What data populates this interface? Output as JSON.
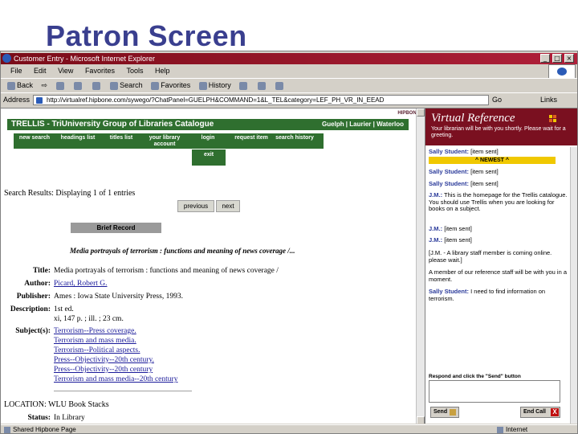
{
  "slide": {
    "title": "Patron Screen"
  },
  "window": {
    "title": "Customer Entry - Microsoft Internet Explorer",
    "controls": {
      "minimize": "_",
      "maximize": "□",
      "close": "×"
    }
  },
  "menu": {
    "items": [
      "File",
      "Edit",
      "View",
      "Favorites",
      "Tools",
      "Help"
    ]
  },
  "toolbar": {
    "items": [
      {
        "label": "Back",
        "icon": "back-arrow-icon"
      },
      {
        "label": "⇨",
        "icon": "forward-arrow-icon"
      },
      {
        "label": "Stop",
        "icon": "stop-icon"
      },
      {
        "label": "Refresh",
        "icon": "refresh-icon"
      },
      {
        "label": "Home",
        "icon": "home-icon"
      },
      {
        "label": "Search",
        "icon": "search-icon"
      },
      {
        "label": "Favorites",
        "icon": "favorites-icon"
      },
      {
        "label": "History",
        "icon": "history-icon"
      },
      {
        "label": "Mail",
        "icon": "mail-icon"
      },
      {
        "label": "Print",
        "icon": "print-icon"
      },
      {
        "label": "Edit",
        "icon": "edit-icon"
      }
    ]
  },
  "address": {
    "label": "Address",
    "value": "http://virtualref.hipbone.com/sywego/?ChatPanel=GUELPH&COMMAND=1&L_TEL&category=LEF_PH_VR_IN_EEAD",
    "go": "Go",
    "links": "Links"
  },
  "catalogue": {
    "hipbone": "HIPBONE",
    "header_title": "TRELLIS - TriUniversity Group of Libraries Catalogue",
    "header_unis": "Guelph | Laurier | Waterloo",
    "nav": [
      "new search",
      "headings list",
      "titles list",
      "your library account",
      "login",
      "request item",
      "search history"
    ],
    "exit": "exit",
    "results_line": "Search Results: Displaying 1 of 1 entries",
    "previous": "previous",
    "next": "next",
    "brief_record": "Brief Record",
    "record_heading": "Media portrayals of terrorism : functions and meaning of news coverage /...",
    "fields": {
      "title_label": "Title:",
      "title_value": "Media portrayals of terrorism : functions and meaning of news coverage /",
      "author_label": "Author:",
      "author_value": "Picard, Robert G.",
      "publisher_label": "Publisher:",
      "publisher_value": "Ames : Iowa State University Press, 1993.",
      "description_label": "Description:",
      "description_value_1": "1st ed.",
      "description_value_2": "xi, 147 p. ; ill. ; 23 cm.",
      "subjects_label": "Subject(s):",
      "subjects": [
        "Terrorism--Press coverage.",
        "Terrorism and mass media.",
        "Terrorism--Political aspects.",
        "Press--Objectivity--20th century.",
        "Press--Objectivity--20th century",
        "Terrorism and mass media--20th century"
      ]
    },
    "location": "LOCATION: WLU Book Stacks",
    "status_label": "Status:",
    "status_value": "In Library"
  },
  "virtual_reference": {
    "title": "Virtual Reference",
    "subtitle": "Your librarian will be with you shortly. Please wait for a greeting.",
    "newest_label": "^ NEWEST ^",
    "messages": [
      {
        "who": "Sally Student:",
        "text": "[item sent]",
        "kind": "student"
      },
      {
        "who": "Sally Student:",
        "text": "[item sent]",
        "kind": "student"
      },
      {
        "who": "Sally Student:",
        "text": "[item sent]",
        "kind": "student"
      },
      {
        "who": "J.M.:",
        "text": "This is the homepage for the Trellis catalogue. You should use Trellis when you are looking for books on a subject.",
        "kind": "librarian"
      },
      {
        "who": "J.M.:",
        "text": "[item sent]",
        "kind": "librarian"
      },
      {
        "who": "J.M.:",
        "text": "[item sent]",
        "kind": "librarian"
      },
      {
        "who": "",
        "text": "[J.M. - A library staff member is coming online. please wait.]",
        "kind": "system"
      },
      {
        "who": "",
        "text": "A member of our reference staff will be with you in a moment.",
        "kind": "system"
      },
      {
        "who": "Sally Student:",
        "text": "I need to find information on terrorism.",
        "kind": "student"
      }
    ],
    "respond_label": "Respond and click the \"Send\" button",
    "send": "Send",
    "end_call": "End Call"
  },
  "statusbar": {
    "left": "Shared Hipbone Page",
    "right": "Internet"
  },
  "colors": {
    "title": "#3a3f8f",
    "trellis_green": "#2f6f2f",
    "vr_maroon": "#7a1020",
    "newest_yellow": "#f0c800",
    "titlebar": "#7a0c18"
  }
}
